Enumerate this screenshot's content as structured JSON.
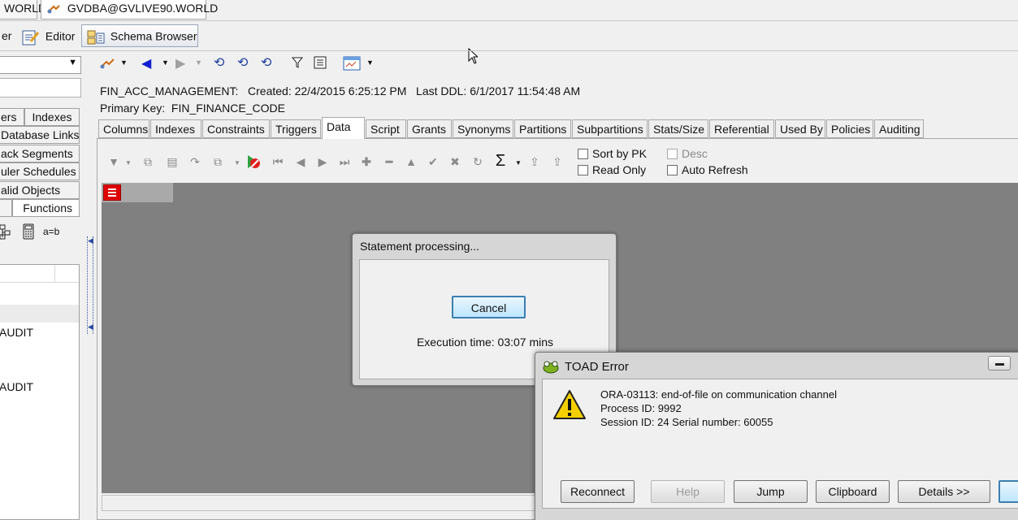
{
  "doc_tabs": [
    {
      "label": "WORLD"
    },
    {
      "label": "GVDBA@GVLIVE90.WORLD"
    }
  ],
  "toolbar": {
    "left_partial": "er",
    "editor": "Editor",
    "schema_browser": "Schema Browser"
  },
  "left_panel": {
    "tabs": [
      {
        "label": "ers"
      },
      {
        "label": "Indexes"
      },
      {
        "label": "Database Links"
      },
      {
        "label": "ack Segments"
      },
      {
        "label": "uler Schedules"
      },
      {
        "label": "alid Objects"
      },
      {
        "label": "Functions"
      }
    ],
    "filter_text": "a=b",
    "rows": [
      {
        "text": "AUDIT"
      },
      {
        "text": "AUDIT"
      }
    ]
  },
  "object_info": {
    "line1": "FIN_ACC_MANAGEMENT:   Created: 22/4/2015 6:25:12 PM   Last DDL: 6/1/2017 11:54:48 AM",
    "line2": "Primary Key:  FIN_FINANCE_CODE"
  },
  "object_tabs": [
    {
      "label": "Columns"
    },
    {
      "label": "Indexes"
    },
    {
      "label": "Constraints"
    },
    {
      "label": "Triggers"
    },
    {
      "label": "Data",
      "active": true
    },
    {
      "label": "Script"
    },
    {
      "label": "Grants"
    },
    {
      "label": "Synonyms"
    },
    {
      "label": "Partitions"
    },
    {
      "label": "Subpartitions"
    },
    {
      "label": "Stats/Size"
    },
    {
      "label": "Referential"
    },
    {
      "label": "Used By"
    },
    {
      "label": "Policies"
    },
    {
      "label": "Auditing"
    }
  ],
  "data_options": {
    "sort_by_pk": "Sort by PK",
    "read_only": "Read Only",
    "desc": "Desc",
    "auto_refresh": "Auto Refresh"
  },
  "processing_dialog": {
    "title": "Statement processing...",
    "cancel": "Cancel",
    "execution_time": "Execution time: 03:07 mins"
  },
  "error_dialog": {
    "title": "TOAD Error",
    "messages": [
      "ORA-03113: end-of-file on communication channel",
      "Process ID: 9992",
      "Session ID: 24 Serial number: 60055"
    ],
    "buttons": {
      "reconnect": "Reconnect",
      "help": "Help",
      "jump": "Jump",
      "clipboard": "Clipboard",
      "details": "Details >>"
    }
  },
  "colors": {
    "grid_bg": "#808080",
    "accent": "#3c7fb1",
    "error_icon": "#f5d000"
  }
}
